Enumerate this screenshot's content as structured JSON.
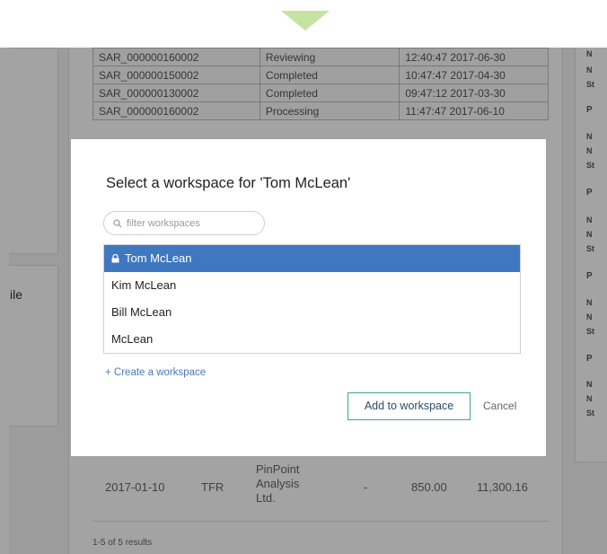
{
  "background": {
    "table_rows": [
      [
        "SAR_000000160002",
        "Reviewing",
        "12:40:47 2017-06-30"
      ],
      [
        "SAR_000000150002",
        "Completed",
        "10:47:47 2017-04-30"
      ],
      [
        "SAR_000000130002",
        "Completed",
        "09:47:12 2017-03-30"
      ],
      [
        "SAR_000000160002",
        "Processing",
        "11:47:47 2017-06-10"
      ]
    ],
    "side_fragment": "ile",
    "transaction_row": {
      "date": "2017-01-10",
      "type": "TFR",
      "payee": "PinPoint Analysis Ltd.",
      "dash": "-",
      "amount": "850.00",
      "balance": "11,300.16"
    },
    "results_text": "1-5 of 5 results",
    "right_panel_letters": [
      "N",
      "N",
      "St",
      "P",
      "N",
      "N",
      "St",
      "P",
      "N",
      "N",
      "St",
      "P",
      "N",
      "N",
      "St",
      "P",
      "N",
      "N",
      "St"
    ]
  },
  "modal": {
    "title": "Select a workspace for 'Tom McLean'",
    "filter_placeholder": "filter workspaces",
    "workspaces": [
      {
        "label": "Tom McLean",
        "selected": true
      },
      {
        "label": "Kim McLean",
        "selected": false
      },
      {
        "label": "Bill McLean",
        "selected": false
      },
      {
        "label": "McLean",
        "selected": false
      }
    ],
    "create_link": "+ Create a workspace",
    "add_button": "Add to workspace",
    "cancel_button": "Cancel",
    "colors": {
      "selected": "#3f77c0",
      "accent_border": "#3aa88c",
      "link": "#4a78b8"
    }
  }
}
